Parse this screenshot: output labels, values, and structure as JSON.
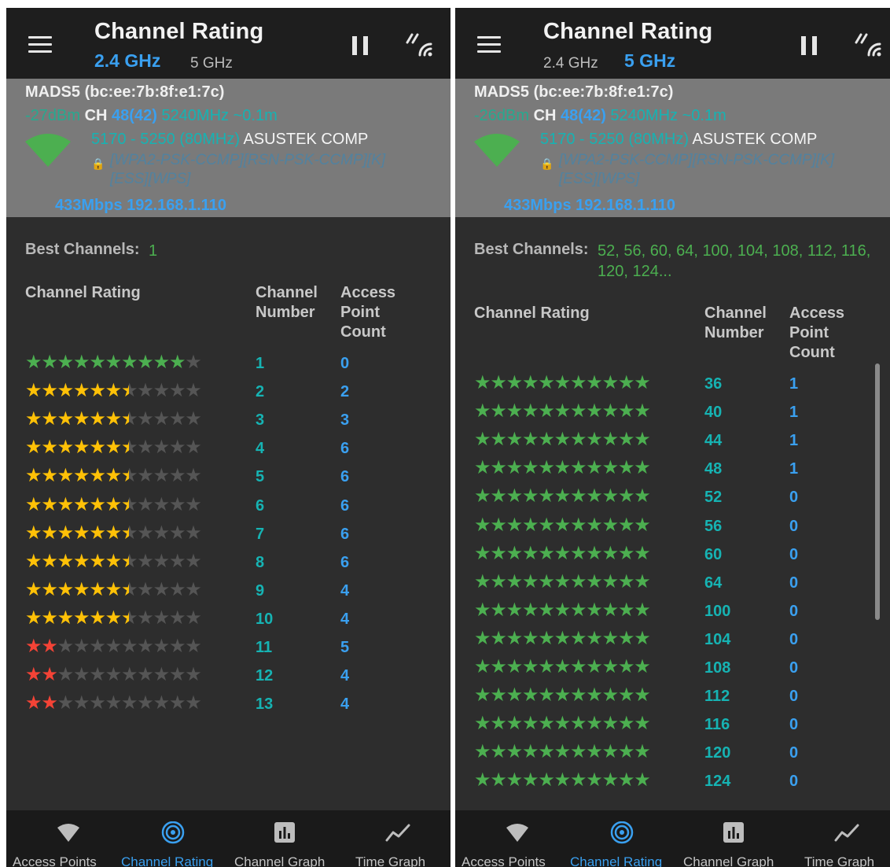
{
  "colors": {
    "accent": "#3aa0f0",
    "star_green": "#4caf50",
    "star_yellow": "#ffc107",
    "star_red": "#f44336",
    "star_empty": "#555555"
  },
  "left": {
    "title": "Channel Rating",
    "bands": [
      {
        "label": "2.4 GHz",
        "active": true
      },
      {
        "label": "5 GHz",
        "active": false
      }
    ],
    "ap": {
      "name": "MADS5 (bc:ee:7b:8f:e1:7c)",
      "signal": "-27dBm",
      "channel_label": "CH",
      "channel": "48(42)",
      "frequency": "5240MHz",
      "distance": "~0.1m",
      "range": "5170 - 5250 (80MHz)",
      "vendor": "ASUSTEK COMP",
      "capabilities": "[WPA2-PSK-CCMP][RSN-PSK-CCMP][K][ESS][WPS]",
      "link": "433Mbps 192.168.1.110"
    },
    "best_label": "Best Channels:",
    "best_channels": "1",
    "headers": {
      "rating": "Channel Rating",
      "number": "Channel Number",
      "count": "Access Point Count"
    },
    "rows": [
      {
        "rating": 10,
        "color": "green",
        "channel": "1",
        "count": "0"
      },
      {
        "rating": 6.5,
        "color": "yellow",
        "channel": "2",
        "count": "2"
      },
      {
        "rating": 6.5,
        "color": "yellow",
        "channel": "3",
        "count": "3"
      },
      {
        "rating": 6.5,
        "color": "yellow",
        "channel": "4",
        "count": "6"
      },
      {
        "rating": 6.5,
        "color": "yellow",
        "channel": "5",
        "count": "6"
      },
      {
        "rating": 6.5,
        "color": "yellow",
        "channel": "6",
        "count": "6"
      },
      {
        "rating": 6.5,
        "color": "yellow",
        "channel": "7",
        "count": "6"
      },
      {
        "rating": 6.5,
        "color": "yellow",
        "channel": "8",
        "count": "6"
      },
      {
        "rating": 6.5,
        "color": "yellow",
        "channel": "9",
        "count": "4"
      },
      {
        "rating": 6.5,
        "color": "yellow",
        "channel": "10",
        "count": "4"
      },
      {
        "rating": 2,
        "color": "red",
        "channel": "11",
        "count": "5"
      },
      {
        "rating": 2,
        "color": "red",
        "channel": "12",
        "count": "4"
      },
      {
        "rating": 2,
        "color": "red",
        "channel": "13",
        "count": "4"
      }
    ]
  },
  "right": {
    "title": "Channel Rating",
    "bands": [
      {
        "label": "2.4 GHz",
        "active": false
      },
      {
        "label": "5 GHz",
        "active": true
      }
    ],
    "ap": {
      "name": "MADS5 (bc:ee:7b:8f:e1:7c)",
      "signal": "-26dBm",
      "channel_label": "CH",
      "channel": "48(42)",
      "frequency": "5240MHz",
      "distance": "~0.1m",
      "range": "5170 - 5250 (80MHz)",
      "vendor": "ASUSTEK COMP",
      "capabilities": "[WPA2-PSK-CCMP][RSN-PSK-CCMP][K][ESS][WPS]",
      "link": "433Mbps 192.168.1.110"
    },
    "best_label": "Best Channels:",
    "best_channels": "52, 56, 60, 64, 100, 104, 108, 112, 116, 120, 124...",
    "headers": {
      "rating": "Channel Rating",
      "number": "Channel Number",
      "count": "Access Point Count"
    },
    "rows": [
      {
        "rating": 11,
        "color": "green",
        "channel": "36",
        "count": "1"
      },
      {
        "rating": 11,
        "color": "green",
        "channel": "40",
        "count": "1"
      },
      {
        "rating": 11,
        "color": "green",
        "channel": "44",
        "count": "1"
      },
      {
        "rating": 11,
        "color": "green",
        "channel": "48",
        "count": "1"
      },
      {
        "rating": 11,
        "color": "green",
        "channel": "52",
        "count": "0"
      },
      {
        "rating": 11,
        "color": "green",
        "channel": "56",
        "count": "0"
      },
      {
        "rating": 11,
        "color": "green",
        "channel": "60",
        "count": "0"
      },
      {
        "rating": 11,
        "color": "green",
        "channel": "64",
        "count": "0"
      },
      {
        "rating": 11,
        "color": "green",
        "channel": "100",
        "count": "0"
      },
      {
        "rating": 11,
        "color": "green",
        "channel": "104",
        "count": "0"
      },
      {
        "rating": 11,
        "color": "green",
        "channel": "108",
        "count": "0"
      },
      {
        "rating": 11,
        "color": "green",
        "channel": "112",
        "count": "0"
      },
      {
        "rating": 11,
        "color": "green",
        "channel": "116",
        "count": "0"
      },
      {
        "rating": 11,
        "color": "green",
        "channel": "120",
        "count": "0"
      },
      {
        "rating": 11,
        "color": "green",
        "channel": "124",
        "count": "0"
      }
    ]
  },
  "nav": [
    {
      "label": "Access Points",
      "icon": "wifi-icon",
      "active": false
    },
    {
      "label": "Channel Rating",
      "icon": "channel-rating-icon",
      "active": true
    },
    {
      "label": "Channel Graph",
      "icon": "bar-chart-icon",
      "active": false
    },
    {
      "label": "Time Graph",
      "icon": "time-graph-icon",
      "active": false
    }
  ]
}
